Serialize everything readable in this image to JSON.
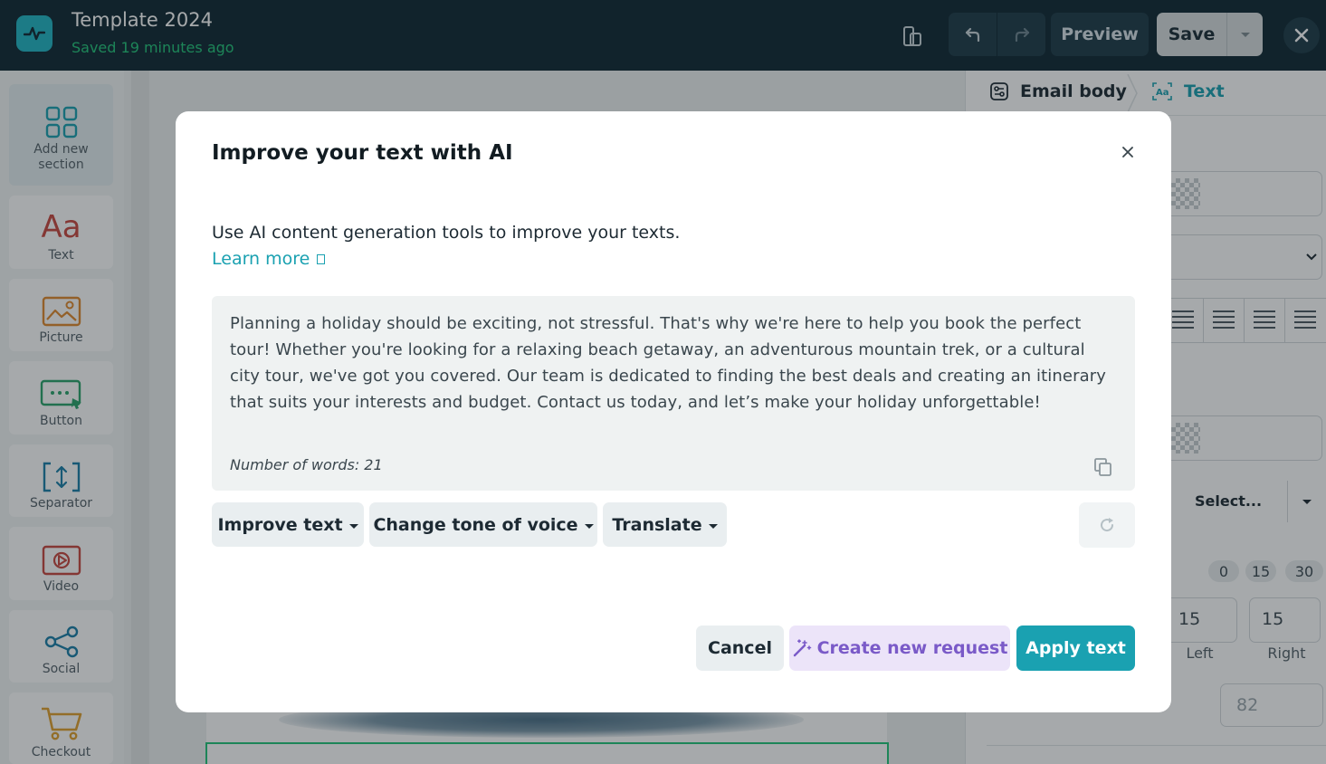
{
  "header": {
    "title": "Template 2024",
    "saved_status": "Saved 19 minutes ago",
    "preview_label": "Preview",
    "save_label": "Save"
  },
  "sidebar": {
    "items": [
      {
        "label": "Add new section",
        "icon": "grid-icon"
      },
      {
        "label": "Text",
        "icon": "text-aa-icon"
      },
      {
        "label": "Picture",
        "icon": "picture-icon"
      },
      {
        "label": "Button",
        "icon": "button-icon"
      },
      {
        "label": "Separator",
        "icon": "separator-icon"
      },
      {
        "label": "Video",
        "icon": "video-icon"
      },
      {
        "label": "Social",
        "icon": "share-icon"
      },
      {
        "label": "Checkout",
        "icon": "cart-icon"
      }
    ]
  },
  "right_panel": {
    "crumb_email": "Email body",
    "crumb_text": "Text",
    "select_placeholder": "Select...",
    "presets": [
      "0",
      "15",
      "30"
    ],
    "left_value": "15",
    "right_value": "15",
    "left_label": "Left",
    "right_label": "Right",
    "line_value": "82"
  },
  "modal": {
    "title": "Improve your text with AI",
    "description": "Use AI content generation tools to improve your texts.",
    "learn_more": "Learn more",
    "body_text": "Planning a holiday should be exciting, not stressful. That's why we're here to help you book the perfect tour! Whether you're looking for a relaxing beach getaway, an adventurous mountain trek, or a cultural city tour, we've got you covered. Our team is dedicated to finding the best deals and creating an itinerary that suits your interests and budget. Contact us today, and let’s make your holiday unforgettable!",
    "word_count": "Number of words: 21",
    "improve_label": "Improve text",
    "tone_label": "Change tone of voice",
    "translate_label": "Translate",
    "cancel_label": "Cancel",
    "create_label": "Create new request",
    "apply_label": "Apply text"
  },
  "colors": {
    "topbar": "#0f2732",
    "accent": "#1aa1b1",
    "saved_green": "#23c57a",
    "create_purple": "#7a5ac8"
  }
}
